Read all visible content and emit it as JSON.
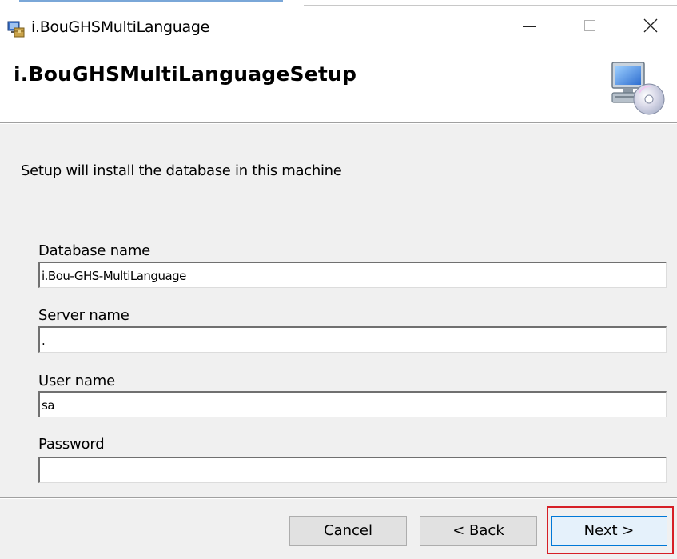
{
  "window": {
    "title": "i.BouGHSMultiLanguage",
    "controls": {
      "minimize_icon": "minimize-icon",
      "maximize_icon": "maximize-icon",
      "close_icon": "close-icon",
      "close_glyph": "✕"
    }
  },
  "banner": {
    "title": "i.BouGHSMultiLanguageSetup",
    "icon": "computer-cd-icon"
  },
  "body": {
    "instruction": "Setup will install the database in this machine",
    "fields": [
      {
        "label": "Database name",
        "value": "i.Bou-GHS-MultiLanguage"
      },
      {
        "label": "Server name",
        "value": "."
      },
      {
        "label": "User name",
        "value": "sa"
      },
      {
        "label": "Password",
        "value": ""
      }
    ]
  },
  "footer": {
    "cancel_label": "Cancel",
    "back_label": "< Back",
    "next_label": "Next >"
  },
  "colors": {
    "highlight": "#d61f26",
    "accent": "#0078d7"
  }
}
